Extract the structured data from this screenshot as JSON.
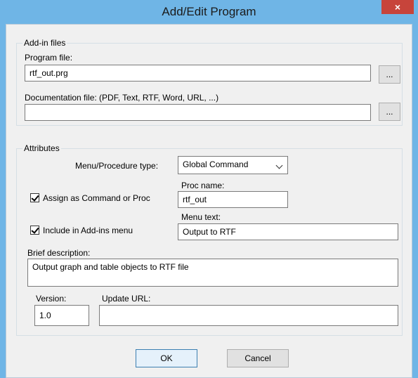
{
  "window": {
    "title": "Add/Edit Program",
    "close_glyph": "×"
  },
  "addin_group": {
    "legend": "Add-in files",
    "program_file_label": "Program file:",
    "program_file_value": "rtf_out.prg",
    "browse_label": "...",
    "documentation_label": "Documentation file:  (PDF, Text, RTF, Word, URL, ...)",
    "documentation_value": "",
    "browse2_label": "..."
  },
  "attributes_group": {
    "legend": "Attributes",
    "menu_type_label": "Menu/Procedure type:",
    "menu_type_value": "Global Command",
    "assign_checkbox_label": "Assign as Command or Proc",
    "proc_name_label": "Proc name:",
    "proc_name_value": "rtf_out",
    "include_checkbox_label": "Include in Add-ins menu",
    "menu_text_label": "Menu text:",
    "menu_text_value": "Output to RTF",
    "brief_description_label": "Brief description:",
    "brief_description_value": "Output graph and table objects to RTF file",
    "version_label": "Version:",
    "version_value": "1.0",
    "update_url_label": "Update URL:",
    "update_url_value": ""
  },
  "buttons": {
    "ok": "OK",
    "cancel": "Cancel"
  },
  "state": {
    "assign_checked": true,
    "include_checked": true
  }
}
